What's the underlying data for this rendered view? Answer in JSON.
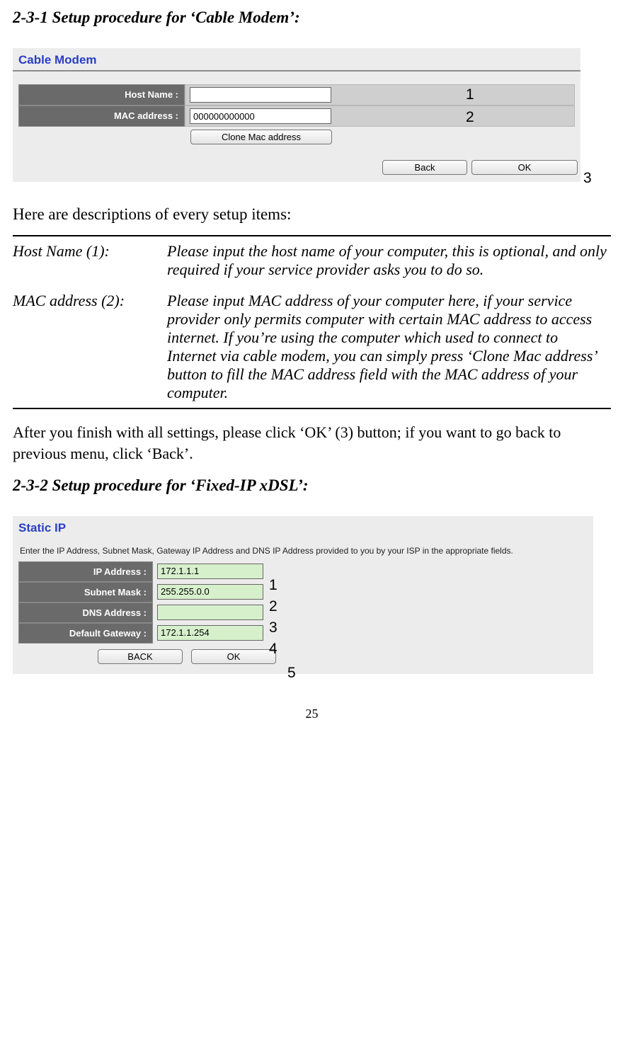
{
  "section1": {
    "heading": "2-3-1 Setup procedure for ‘Cable Modem’:",
    "panelTitle": "Cable Modem",
    "hostNameLabel": "Host Name :",
    "hostNameValue": "",
    "macLabel": "MAC address :",
    "macValue": "000000000000",
    "cloneBtn": "Clone Mac address",
    "backBtn": "Back",
    "okBtn": "OK",
    "callout1": "1",
    "callout2": "2",
    "callout3": "3"
  },
  "descIntro": "Here are descriptions of every setup items:",
  "desc": {
    "term1": "Host Name (1):",
    "def1": "Please input the host name of your computer, this is optional, and only required if your service provider asks you to do so.",
    "term2": "MAC address (2):",
    "def2": "Please input MAC address of your computer here, if your service provider only permits computer with certain MAC address to access internet. If you’re using the computer which used to connect to Internet via cable modem, you can simply press ‘Clone Mac address’ button to fill the MAC address field with the MAC address of your computer."
  },
  "afterText": "After you finish with all settings, please click ‘OK’ (3) button; if you want to go back to previous menu, click ‘Back’.",
  "section2": {
    "heading": "2-3-2 Setup procedure for ‘Fixed-IP xDSL’:",
    "panelTitle": "Static IP",
    "panelSub": "Enter the IP Address, Subnet Mask, Gateway IP Address and DNS IP Address provided to you by your ISP in the appropriate fields.",
    "ipLabel": "IP Address :",
    "ipValue": "172.1.1.1",
    "maskLabel": "Subnet Mask :",
    "maskValue": "255.255.0.0",
    "dnsLabel": "DNS Address :",
    "dnsValue": "",
    "gwLabel": "Default Gateway :",
    "gwValue": "172.1.1.254",
    "backBtn": "BACK",
    "okBtn": "OK",
    "callout1": "1",
    "callout2": "2",
    "callout3": "3",
    "callout4": "4",
    "callout5": "5"
  },
  "pageNumber": "25"
}
